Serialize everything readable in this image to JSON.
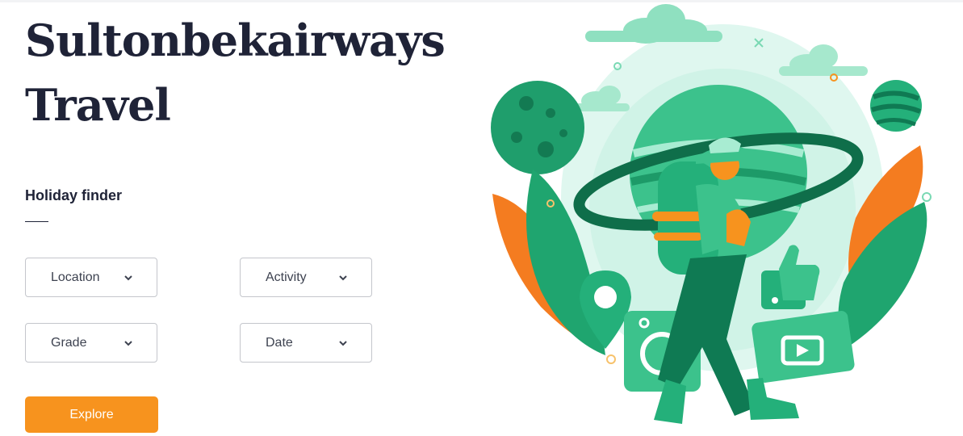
{
  "hero": {
    "title_line1": "Sultonbekairways",
    "title_line2": "Travel"
  },
  "finder": {
    "heading": "Holiday finder",
    "selects": [
      {
        "label": "Location",
        "icon": "chevron-down-icon"
      },
      {
        "label": "Activity",
        "icon": "chevron-down-icon"
      },
      {
        "label": "Grade",
        "icon": "chevron-down-icon"
      },
      {
        "label": "Date",
        "icon": "chevron-down-icon"
      }
    ],
    "explore_label": "Explore"
  },
  "colors": {
    "accent": "#f7931e",
    "title": "#1f2337",
    "green_dark": "#0f7a53",
    "green": "#24b07a",
    "green_light": "#bff0de",
    "orange": "#f7931e"
  }
}
